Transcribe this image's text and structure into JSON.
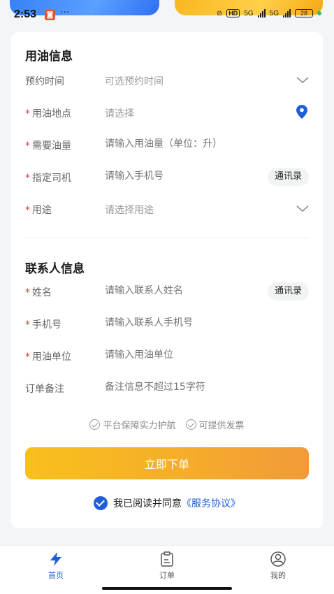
{
  "status_bar": {
    "time": "2:53",
    "dots": "···",
    "hd": "HD",
    "net1": "5G",
    "net2": "5G",
    "battery": "28"
  },
  "fuel_section": {
    "title": "用油信息",
    "rows": [
      {
        "label": "预约时间",
        "required": false,
        "placeholder": "可选预约时间"
      },
      {
        "label": "用油地点",
        "required": true,
        "placeholder": "请选择"
      },
      {
        "label": "需要油量",
        "required": true,
        "placeholder": "请输入用油量（单位：升）"
      },
      {
        "label": "指定司机",
        "required": true,
        "placeholder": "请输入手机号",
        "button": "通讯录"
      },
      {
        "label": "用途",
        "required": true,
        "placeholder": "请选择用途"
      }
    ]
  },
  "contact_section": {
    "title": "联系人信息",
    "rows": [
      {
        "label": "姓名",
        "required": true,
        "placeholder": "请输入联系人姓名",
        "button": "通讯录"
      },
      {
        "label": "手机号",
        "required": true,
        "placeholder": "请输入联系人手机号"
      },
      {
        "label": "用油单位",
        "required": true,
        "placeholder": "请输入用油单位"
      },
      {
        "label": "订单备注",
        "required": false,
        "placeholder": "备注信息不超过15字符"
      }
    ]
  },
  "required_mark": "*",
  "guarantees": [
    "平台保障实力护航",
    "可提供发票"
  ],
  "submit_label": "立即下单",
  "agreement": {
    "text": "我已阅读并同意",
    "link": "《服务协议》"
  },
  "tabs": [
    {
      "label": "首页",
      "icon": "lightning-icon",
      "active": true
    },
    {
      "label": "订单",
      "icon": "clipboard-icon",
      "active": false
    },
    {
      "label": "我的",
      "icon": "user-icon",
      "active": false
    }
  ],
  "colors": {
    "accent": "#1f5ed8",
    "button_start": "#f8c01d",
    "button_end": "#f19a3a",
    "required": "#e53935"
  }
}
